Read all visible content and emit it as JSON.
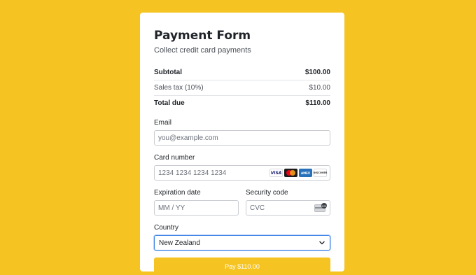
{
  "form": {
    "title": "Payment Form",
    "subtitle": "Collect credit card payments"
  },
  "summary": {
    "rows": [
      {
        "label": "Subtotal",
        "value": "$100.00"
      },
      {
        "label": "Sales tax (10%)",
        "value": "$10.00"
      },
      {
        "label": "Total due",
        "value": "$110.00"
      }
    ]
  },
  "email": {
    "label": "Email",
    "placeholder": "you@example.com"
  },
  "card_number": {
    "label": "Card number",
    "placeholder": "1234 1234 1234 1234",
    "brands": [
      "VISA",
      "mastercard",
      "AMEX",
      "DISCOVER"
    ]
  },
  "expiration": {
    "label": "Expiration date",
    "placeholder": "MM / YY"
  },
  "security": {
    "label": "Security code",
    "placeholder": "CVC",
    "icon": "cvc-card-icon",
    "badge": "123"
  },
  "country": {
    "label": "Country",
    "selected": "New Zealand"
  },
  "pay_button": {
    "label": "Pay $110.00"
  },
  "colors": {
    "background": "#f5c322",
    "focus": "#3b82e6"
  }
}
